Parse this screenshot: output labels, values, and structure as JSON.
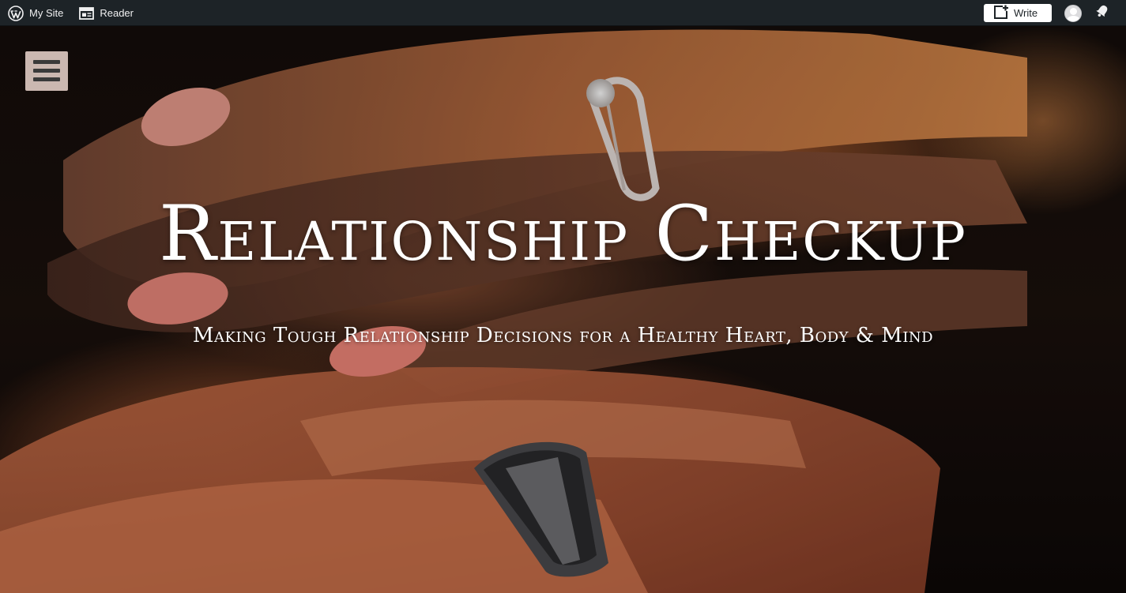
{
  "adminbar": {
    "wp_logo_icon": "wordpress-logo-icon",
    "my_site_label": "My Site",
    "reader_label": "Reader",
    "reader_icon": "reader-icon",
    "write_label": "Write",
    "write_icon": "write-post-icon",
    "avatar_icon": "user-avatar-icon",
    "notifications_icon": "bell-icon"
  },
  "header": {
    "menu_icon": "hamburger-menu-icon",
    "title": "Relationship Checkup",
    "tagline": "Making Tough Relationship Decisions for a Healthy Heart, Body & Mind"
  },
  "colors": {
    "adminbar_bg": "#1d2327",
    "adminbar_text": "#f0f0f1",
    "menu_toggle_bg": "#cbb8b1",
    "title_text": "#ffffff"
  }
}
